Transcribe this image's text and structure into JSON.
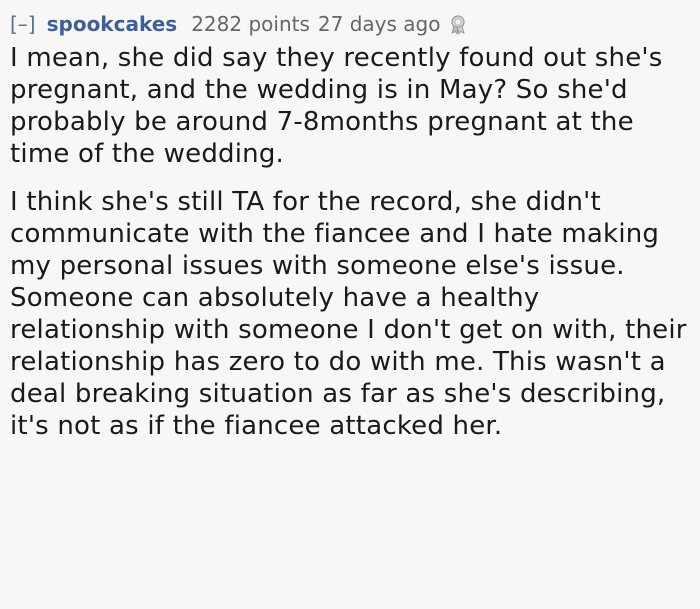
{
  "comment": {
    "collapse_label": "[–]",
    "author": "spookcakes",
    "score": "2282 points",
    "age": "27 days ago",
    "award_icon": "silver-award-icon",
    "paragraphs": [
      "I mean, she did say they recently found out she's pregnant, and the wedding is in May? So she'd probably be around 7-8months pregnant at the time of the wedding.",
      "I think she's still TA for the record, she didn't communicate with the fiancee and I hate making my personal issues with someone else's issue. Someone can absolutely have a healthy relationship with someone I don't get on with, their relationship has zero to do with me. This wasn't a deal breaking situation as far as she's describing, it's not as if the fiancee attacked her."
    ]
  },
  "colors": {
    "background": "#f7f7f5",
    "author": "#3f5f98",
    "meta": "#666666",
    "text": "#1a1a1a"
  }
}
